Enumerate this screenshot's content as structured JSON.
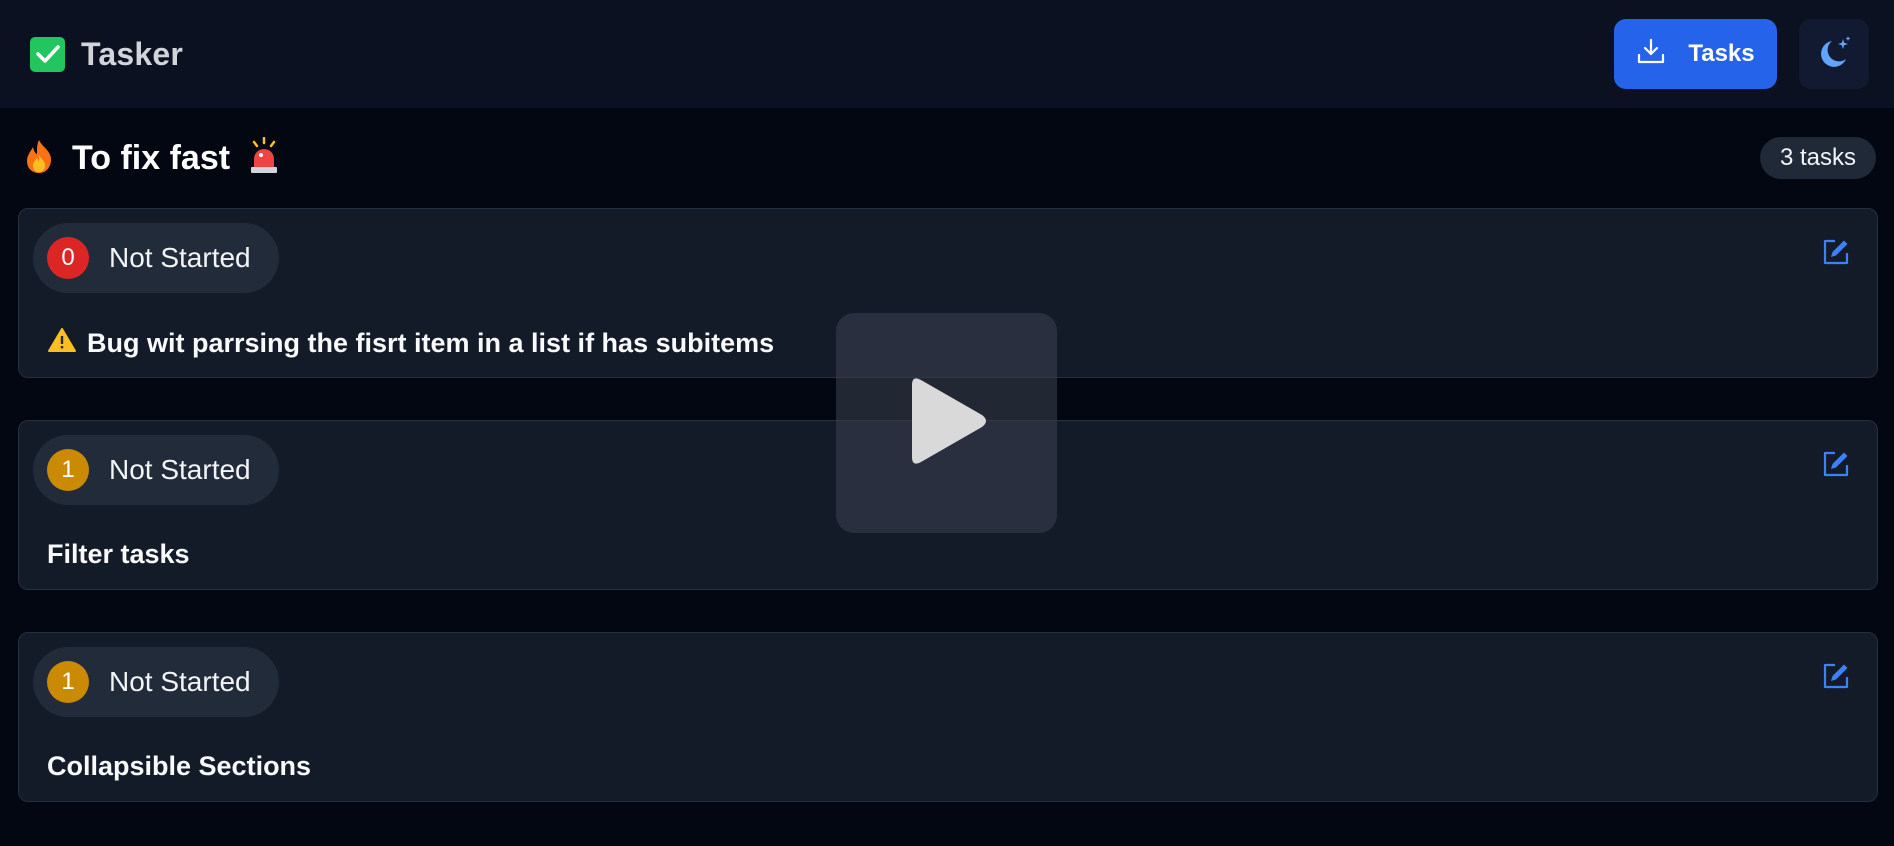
{
  "app": {
    "title": "Tasker",
    "logo_icon": "check-square-icon"
  },
  "header": {
    "download_button_label": "Tasks",
    "download_icon": "download-icon",
    "theme_icon": "moon-stars-icon"
  },
  "section": {
    "title": "To fix fast",
    "leading_emoji": "🔥",
    "trailing_emoji": "🚨",
    "count_label": "3 tasks"
  },
  "tasks": [
    {
      "priority": "0",
      "priority_color": "#dc2626",
      "status": "Not Started",
      "title": "Bug wit parrsing the fisrt item in a list if has subitems",
      "has_warning": true,
      "warning_emoji": "⚠️"
    },
    {
      "priority": "1",
      "priority_color": "#ca8a04",
      "status": "Not Started",
      "title": "Filter tasks",
      "has_warning": false
    },
    {
      "priority": "1",
      "priority_color": "#ca8a04",
      "status": "Not Started",
      "title": "Collapsible Sections",
      "has_warning": false
    }
  ],
  "overlay": {
    "icon": "play-icon"
  },
  "colors": {
    "accent": "#2563eb",
    "edit_icon": "#3b82f6",
    "logo": "#22c55e"
  }
}
